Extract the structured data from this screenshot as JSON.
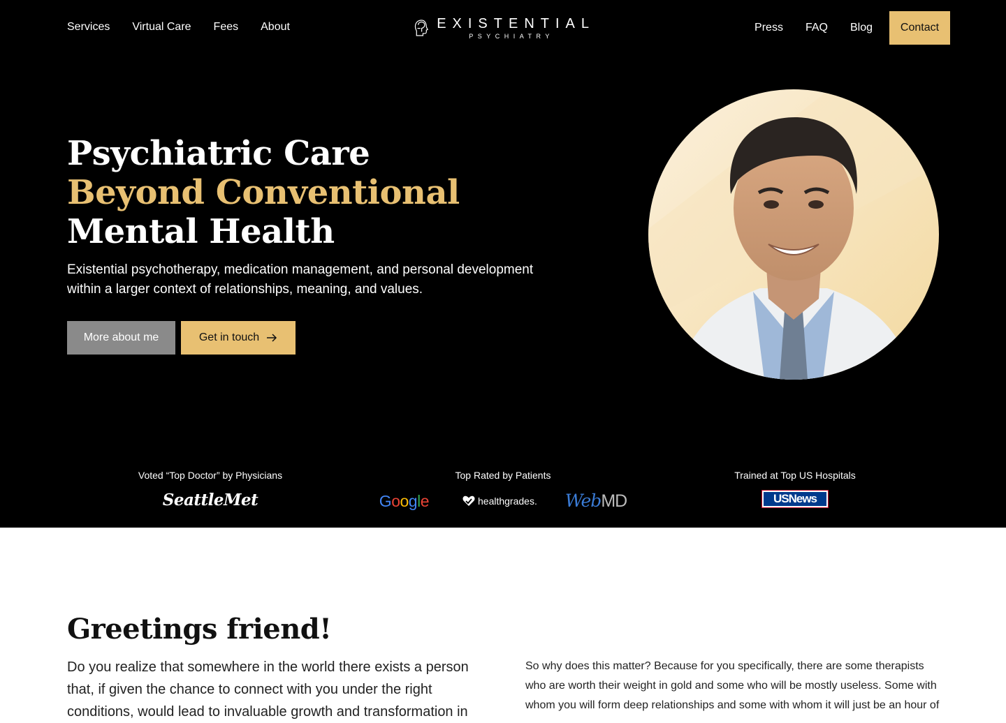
{
  "nav": {
    "left_links": [
      "Services",
      "Virtual Care",
      "Fees",
      "About"
    ],
    "right_links": [
      "Press",
      "FAQ",
      "Blog"
    ],
    "contact_label": "Contact",
    "logo_main": "EXISTENTIAL",
    "logo_sub": "PSYCHIATRY"
  },
  "hero": {
    "headline_line1": "Psychiatric Care",
    "headline_line2": "Beyond Conventional",
    "headline_line3": "Mental Health",
    "subtext": "Existential psychotherapy, medication management, and personal development within a larger context of relationships, meaning, and values.",
    "button_more": "More about me",
    "button_contact": "Get in touch"
  },
  "credentials": {
    "item1_label": "Voted “Top Doctor” by Physicians",
    "item1_logo": "SeattleMet",
    "item2_label": "Top Rated by Patients",
    "item2_logo_google": "Google",
    "item2_logo_hg": "healthgrades.",
    "item2_logo_webmd_a": "Web",
    "item2_logo_webmd_b": "MD",
    "item3_label": "Trained at Top US Hospitals",
    "item3_logo": "USNews"
  },
  "intro": {
    "heading": "Greetings friend!",
    "left_text": "Do you realize that somewhere in the world there exists a person that, if given the chance to connect with you under the right conditions, would lead to invaluable growth and transformation in",
    "right_text": "So why does this matter? Because for you specifically, there are some therapists who are worth their weight in gold and some who will be mostly useless. Some with whom you will form deep relationships and some with whom it will just be an hour of"
  },
  "colors": {
    "accent": "#e8c072",
    "hero_bg": "#000000",
    "button_gray": "#8a8a8a"
  }
}
